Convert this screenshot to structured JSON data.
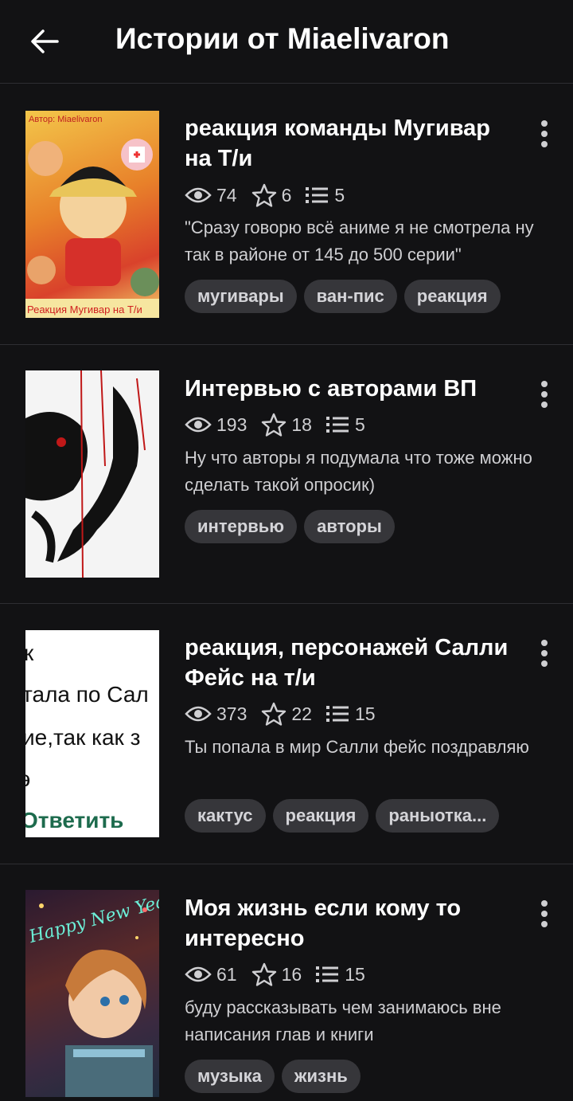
{
  "header": {
    "back_icon": "arrow-left-icon",
    "title": "Истории от Miaelivaron"
  },
  "stories": [
    {
      "title": "реакция команды Мугивар на Т/и",
      "views": "74",
      "stars": "6",
      "chapters": "5",
      "description": "\"Сразу говорю всё аниме я не смотрела ну так в районе от 145 до 500 серии\"",
      "tags": [
        "мугивары",
        "ван-пис",
        "реакция"
      ],
      "cover_text_top": "Автор: Miaelivaron",
      "cover_text_bottom": "Реакция Мугивар на Т/и"
    },
    {
      "title": "Интервью с авторами ВП",
      "views": "193",
      "stars": "18",
      "chapters": "5",
      "description": "Ну что авторы я подумала что тоже можно сделать такой опросик)",
      "tags": [
        "интервью",
        "авторы"
      ]
    },
    {
      "title": "реакция, персонажей Салли Фейс на т/и",
      "views": "373",
      "stars": "22",
      "chapters": "15",
      "description": "Ты попала в мир Салли фейс поздравляю",
      "tags": [
        "кактус",
        "реакция",
        "раныотка..."
      ],
      "cover_lines": [
        "к",
        "тала по Сал",
        "ие,так как з",
        "э",
        "Ответить"
      ]
    },
    {
      "title": "Моя жизнь если кому то интересно",
      "views": "61",
      "stars": "16",
      "chapters": "15",
      "description": "буду рассказывать чем занимаюсь вне написания глав и книги",
      "tags": [
        "музыка",
        "жизнь"
      ],
      "cover_text": "Happy New Year!"
    }
  ],
  "icons": {
    "views": "eye-icon",
    "stars": "star-icon",
    "chapters": "list-icon",
    "menu": "more-vertical-icon"
  },
  "colors": {
    "background": "#121214",
    "tag_bg": "#36363a",
    "divider": "#2e2e32"
  }
}
